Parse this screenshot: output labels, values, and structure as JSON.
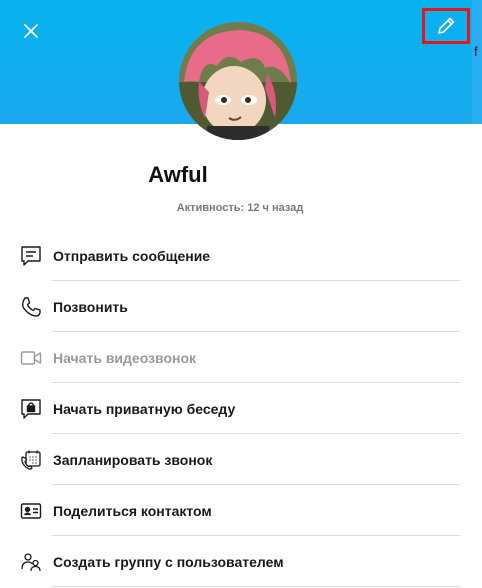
{
  "header": {
    "close_icon": "close-icon",
    "edit_icon": "pencil-icon",
    "accent_color": "#06b3ee",
    "highlight_color": "#e8141b"
  },
  "profile": {
    "name": "Awful",
    "status": "Активность: 12 ч назад"
  },
  "actions": [
    {
      "label": "Отправить сообщение",
      "icon": "message-icon",
      "enabled": true
    },
    {
      "label": "Позвонить",
      "icon": "phone-icon",
      "enabled": true
    },
    {
      "label": "Начать видеозвонок",
      "icon": "video-icon",
      "enabled": false
    },
    {
      "label": "Начать приватную беседу",
      "icon": "lock-chat-icon",
      "enabled": true
    },
    {
      "label": "Запланировать звонок",
      "icon": "schedule-call-icon",
      "enabled": true
    },
    {
      "label": "Поделиться контактом",
      "icon": "contact-card-icon",
      "enabled": true
    },
    {
      "label": "Создать группу с пользователем",
      "icon": "group-icon",
      "enabled": true
    }
  ]
}
